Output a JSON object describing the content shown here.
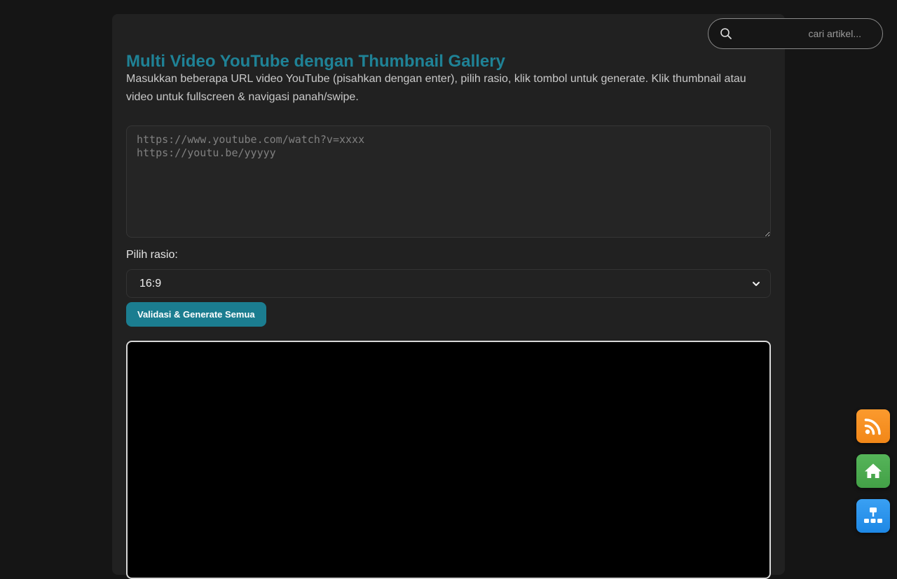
{
  "page": {
    "title": "Multi Video YouTube dengan Thumbnail Gallery",
    "description": "Masukkan beberapa URL video YouTube (pisahkan dengan enter), pilih rasio, klik tombol untuk generate. Klik thumbnail atau video untuk fullscreen & navigasi panah/swipe."
  },
  "form": {
    "urls_value": "",
    "urls_placeholder": "https://www.youtube.com/watch?v=xxxx\nhttps://youtu.be/yyyyy",
    "ratio_label": "Pilih rasio:",
    "ratio_selected": "16:9",
    "generate_label": "Validasi & Generate Semua"
  },
  "search": {
    "placeholder": "cari artikel..."
  },
  "floating_buttons": [
    {
      "icon": "rss-icon",
      "color": "#f7931e"
    },
    {
      "icon": "home-icon",
      "color": "#4caf50"
    },
    {
      "icon": "sitemap-icon",
      "color": "#2196f3"
    }
  ],
  "colors": {
    "accent": "#1f8296",
    "button": "#1b7d90",
    "background": "#151515",
    "card": "#212121"
  }
}
